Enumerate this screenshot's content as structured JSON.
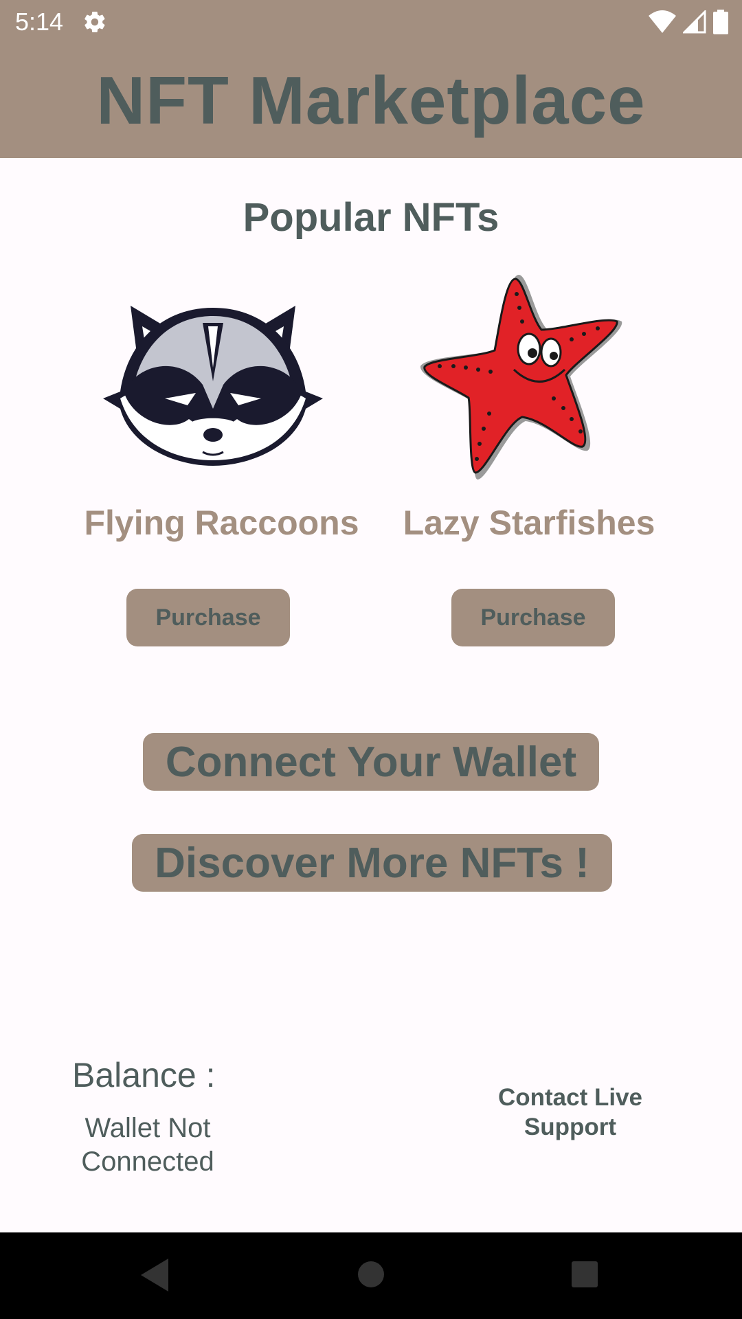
{
  "status_bar": {
    "time": "5:14",
    "icons": [
      "gear-icon",
      "wifi-icon",
      "signal-icon",
      "battery-icon"
    ]
  },
  "app": {
    "title": "NFT Marketplace",
    "colors": {
      "bar": "#a38f80",
      "text": "#4f5d5c",
      "background": "#fffbfe"
    }
  },
  "main": {
    "section_title": "Popular NFTs",
    "nfts": [
      {
        "name": "Flying Raccoons",
        "image_icon": "raccoon-icon",
        "purchase_label": "Purchase"
      },
      {
        "name": "Lazy Starfishes",
        "image_icon": "starfish-icon",
        "purchase_label": "Purchase"
      }
    ],
    "connect_wallet_label": "Connect Your Wallet",
    "discover_label": "Discover More NFTs !"
  },
  "footer": {
    "balance_label": "Balance :",
    "balance_value": "Wallet Not Connected",
    "support_label": "Contact Live Support"
  },
  "nav_bar": {
    "buttons": [
      "back-icon",
      "home-icon",
      "recents-icon"
    ]
  }
}
